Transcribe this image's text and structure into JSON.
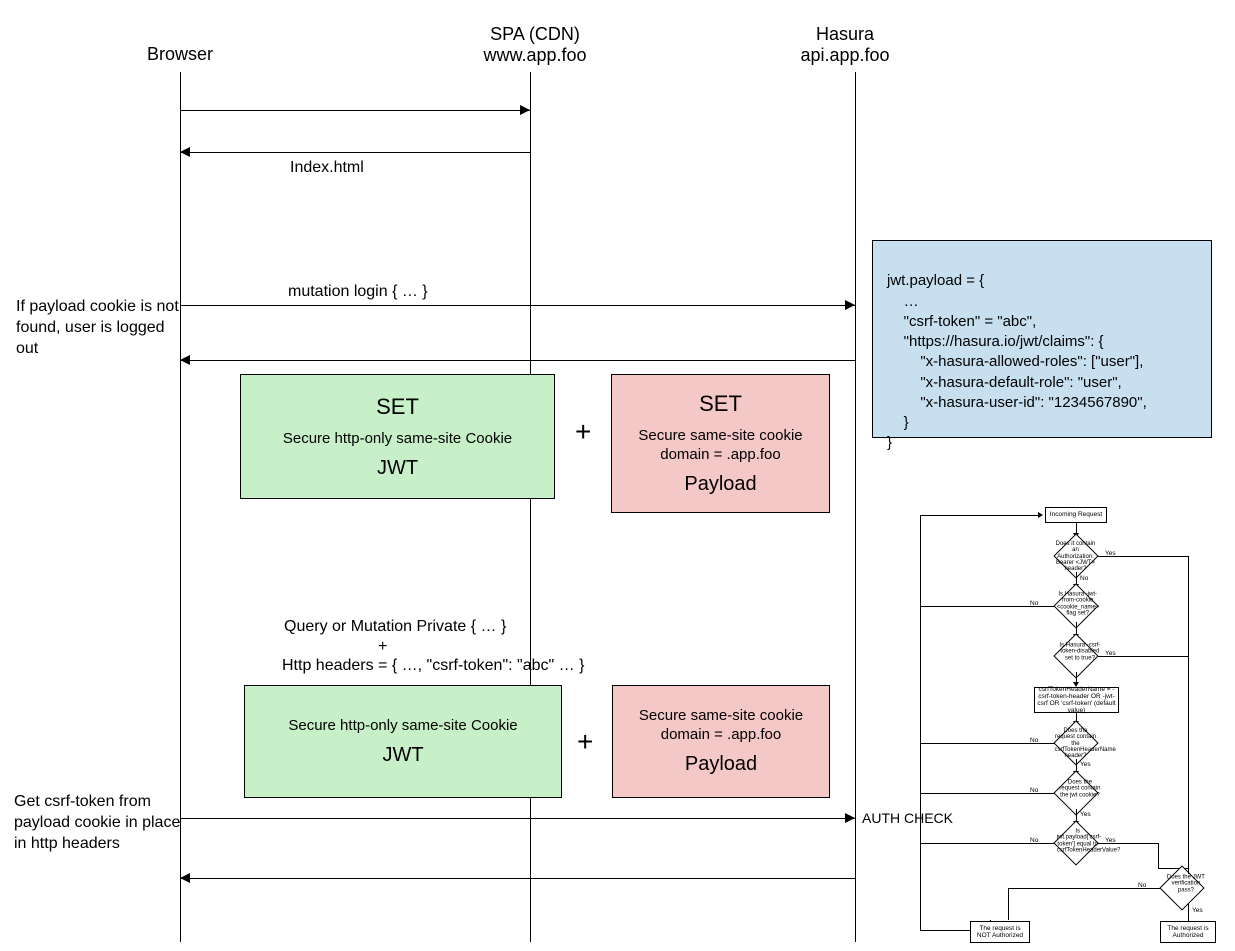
{
  "actors": {
    "browser": {
      "title": "Browser"
    },
    "spa": {
      "title": "SPA (CDN)",
      "sub": "www.app.foo"
    },
    "hasura": {
      "title": "Hasura",
      "sub": "api.app.foo"
    }
  },
  "messages": {
    "index_html": "Index.html",
    "mutation_login": "mutation login { … }",
    "query_private": "Query or Mutation Private { … }",
    "plus_small": "+",
    "http_headers": "Http headers = { …, \"csrf-token\": \"abc\" … }"
  },
  "notes": {
    "payload_not_found": "If payload cookie is not found, user is logged out",
    "get_csrf": "Get csrf-token from payload cookie in place in http headers",
    "auth_check": "AUTH CHECK"
  },
  "boxes": {
    "set1_green": {
      "title": "SET",
      "sub": "Secure http-only same-site Cookie",
      "foot": "JWT"
    },
    "set1_red": {
      "title": "SET",
      "sub1": "Secure same-site cookie",
      "sub2": "domain = .app.foo",
      "foot": "Payload"
    },
    "set2_green": {
      "sub": "Secure http-only same-site Cookie",
      "foot": "JWT"
    },
    "set2_red": {
      "sub1": "Secure same-site cookie",
      "sub2": "domain = .app.foo",
      "foot": "Payload"
    },
    "plus1": "+",
    "plus2": "+"
  },
  "jwt_payload": {
    "l1": "jwt.payload = {",
    "l2": "    …",
    "l3": "    \"csrf-token\" = \"abc\",",
    "l4": "    \"https://hasura.io/jwt/claims\": {",
    "l5": "        \"x-hasura-allowed-roles\": [\"user\"],",
    "l6": "        \"x-hasura-default-role\": \"user\",",
    "l7": "        \"x-hasura-user-id\": \"1234567890\",",
    "l8": "    }",
    "l9": "}"
  },
  "flowchart": {
    "incoming": "Incoming Request",
    "d1": "Does it contain an Authorization: Bearer <JWT> header?",
    "d2": "Is Hasura -jwt-from-cookie <cookie_name> flag set?",
    "d3": "Is Hasura -csrf-token-disabled set to true?",
    "b1": "csrfTokenHeaderName = -csrf-token-header OR -jwt-csrf OR 'csrf-token' (default value)",
    "d4": "Does the request contain the csrfTokenHeaderName header?",
    "d5": "Does the request contain the jwt cookie?",
    "d6": "Is jwt.payload['csrf-token'] equal to csrfTokenHeaderValue?",
    "d7": "Does the JWT verification pass?",
    "r_not": "The request is NOT Authorized",
    "r_auth": "The request is Authorized",
    "yes": "Yes",
    "no": "No"
  }
}
